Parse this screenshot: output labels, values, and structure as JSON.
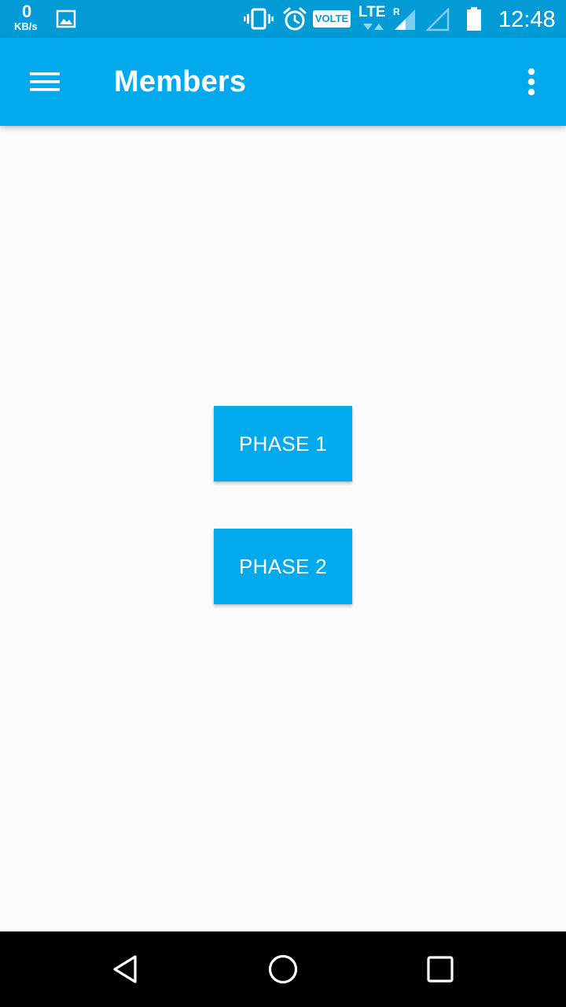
{
  "status_bar": {
    "net_speed_value": "0",
    "net_speed_unit": "KB/s",
    "volte_label": "VOLTE",
    "network_type": "LTE",
    "roaming_indicator": "R",
    "time": "12:48",
    "icons": [
      "image-notification-icon",
      "vibrate-icon",
      "alarm-icon",
      "volte-icon",
      "lte-data-icon",
      "signal-icon",
      "signal-empty-icon",
      "battery-icon"
    ]
  },
  "app_bar": {
    "title": "Members",
    "menu_icon": "hamburger-menu-icon",
    "overflow_icon": "more-vert-icon"
  },
  "main": {
    "buttons": [
      {
        "label": "PHASE 1"
      },
      {
        "label": "PHASE 2"
      }
    ]
  },
  "nav_bar": {
    "icons": [
      "back-icon",
      "home-icon",
      "recents-icon"
    ]
  },
  "colors": {
    "status_bar": "#039bd6",
    "app_bar": "#03a9ed",
    "button": "#03a9ed",
    "background": "#fafafa",
    "nav_bar": "#000000",
    "text_on_primary": "#ffffff"
  }
}
